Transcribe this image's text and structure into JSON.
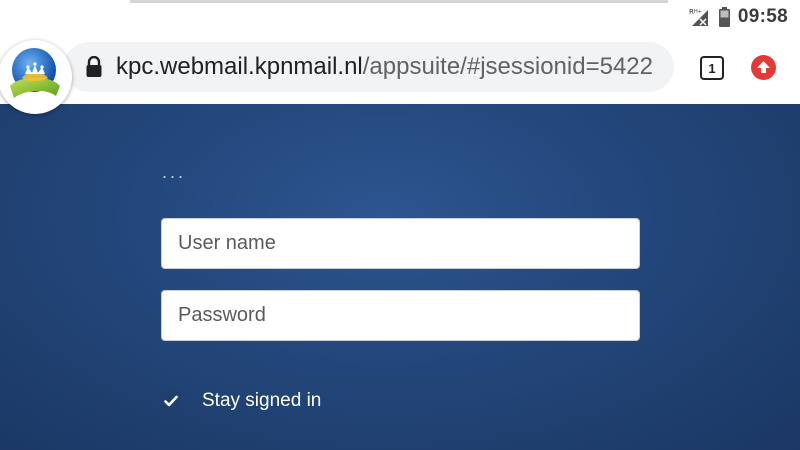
{
  "status_bar": {
    "time": "09:58",
    "icons": [
      "roaming-signal-icon",
      "battery-icon"
    ]
  },
  "browser": {
    "url_host": "kpc.webmail.kpnmail.nl",
    "url_path": "/appsuite/#jsessionid=5422",
    "tab_count": "1",
    "icons": [
      "kpn-crown-logo",
      "lock-icon",
      "tab-counter-icon",
      "update-arrow-icon"
    ],
    "colors": {
      "update": "#e53935"
    }
  },
  "login": {
    "loading_indicator": "...",
    "username_placeholder": "User name",
    "password_placeholder": "Password",
    "stay_signed_in_label": "Stay signed in",
    "stay_signed_in_checked": true,
    "colors": {
      "background": "#24487d",
      "checkbox": "#1f3f6e"
    }
  }
}
